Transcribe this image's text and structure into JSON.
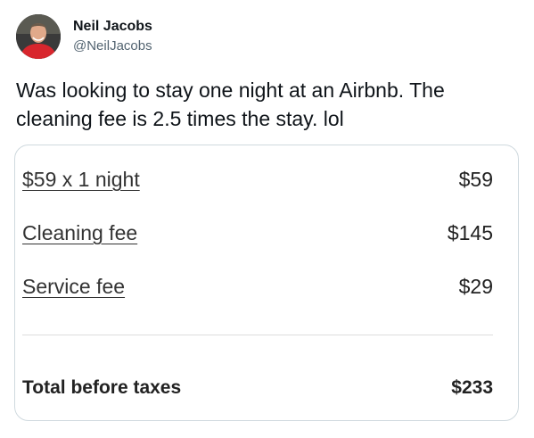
{
  "author": {
    "display_name": "Neil Jacobs",
    "handle": "@NeilJacobs"
  },
  "tweet": {
    "text": "Was looking to stay one night at an Airbnb.  The cleaning fee is 2.5 times the stay. lol"
  },
  "price_breakdown": {
    "items": [
      {
        "label": "$59 x 1 night",
        "amount": "$59"
      },
      {
        "label": "Cleaning fee",
        "amount": "$145"
      },
      {
        "label": "Service fee",
        "amount": "$29"
      }
    ],
    "total": {
      "label": "Total before taxes",
      "amount": "$233"
    }
  },
  "colors": {
    "text_primary": "#0f1419",
    "text_secondary": "#536471",
    "card_border": "#cfd9de"
  }
}
